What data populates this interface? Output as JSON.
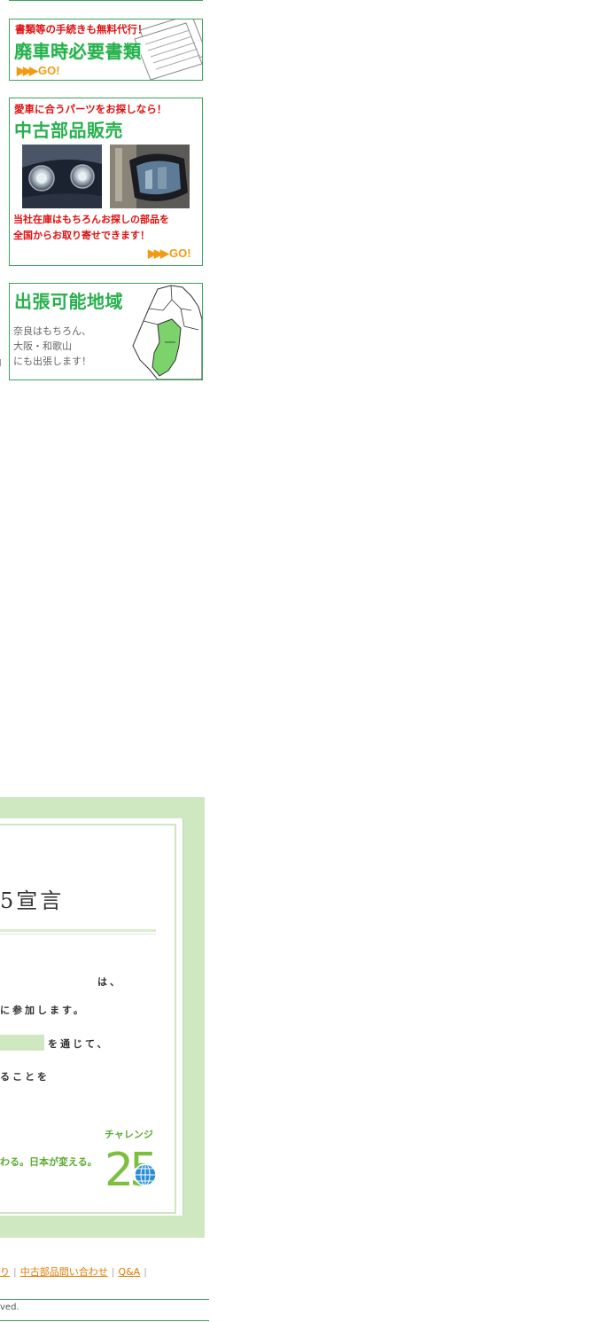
{
  "banners": {
    "docs": {
      "subtitle": "書類等の手続きも無料代行！",
      "title": "廃車時必要書類",
      "go_label": "GO!"
    },
    "parts": {
      "subtitle": "愛車に合うパーツをお探しなら！",
      "title": "中古部品販売",
      "desc_line1": "当社在庫はもちろんお探しの部品を",
      "desc_line2": "全国からお取り寄せできます！",
      "go_label": "GO!"
    },
    "area": {
      "title": "出張可能地域",
      "line1": "奈良はもちろん、",
      "line2": "大阪・和歌山",
      "line3": "にも出張します！"
    }
  },
  "declaration": {
    "headline": "5宣言",
    "line_ha": "は、",
    "line_join": "に参加します。",
    "line_through": "を通じて、",
    "line_koto": "ることを",
    "slogan": "わる。日本が変える。",
    "logo_label": "チャレンジ",
    "logo_number": "25"
  },
  "footer": {
    "links": [
      "り",
      "中古部品問い合わせ",
      "Q&A"
    ],
    "copyright": "ved."
  },
  "colors": {
    "green": "#27b04e",
    "border": "#3aa35a",
    "red": "#e01010",
    "orange": "#f29b12",
    "decl_bg": "#d0e8c2"
  }
}
